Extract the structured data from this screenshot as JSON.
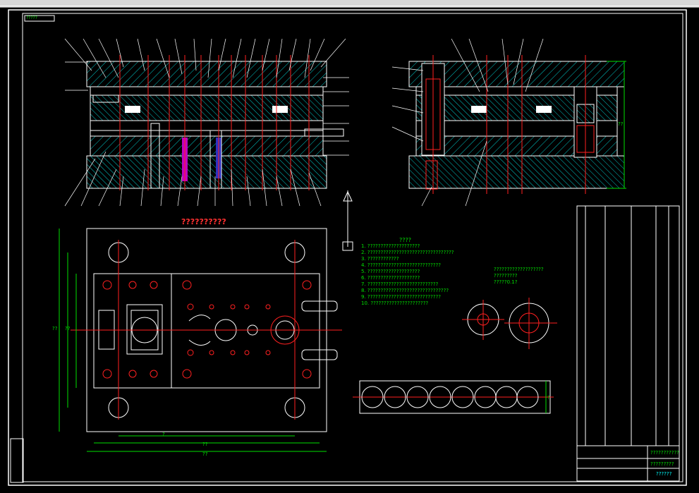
{
  "section_title": "??????????",
  "tech_requirements_title": "????",
  "tech_requirements_lines": [
    "1. ????????????????????",
    "2. ?????????????????????????????????",
    "3. ????????????",
    "4. ????????????????????????????",
    "5. ????????????????????",
    "6. ????????????????????",
    "7. ???????????????????????????",
    "8. ???????????????????????????????",
    "9. ????????????????????????????",
    "10. ??????????????????????"
  ],
  "part_notes": [
    "???????????????????",
    "?????????",
    "?????0.1?"
  ],
  "title_block_main": "???????????",
  "title_block_sub": "?????????",
  "title_block_drawing_no": "??????",
  "stamp_label": "?????",
  "dim_labels": [
    "??",
    "??",
    "??",
    "??",
    "??",
    "?",
    "?"
  ],
  "colors": {
    "frame": "#ffffff",
    "outline": "#ffffff",
    "hatch": "#00c8c8",
    "center": "#ff2020",
    "dimension": "#00e000",
    "label": "#ff3030",
    "spring": "#c000c0"
  }
}
